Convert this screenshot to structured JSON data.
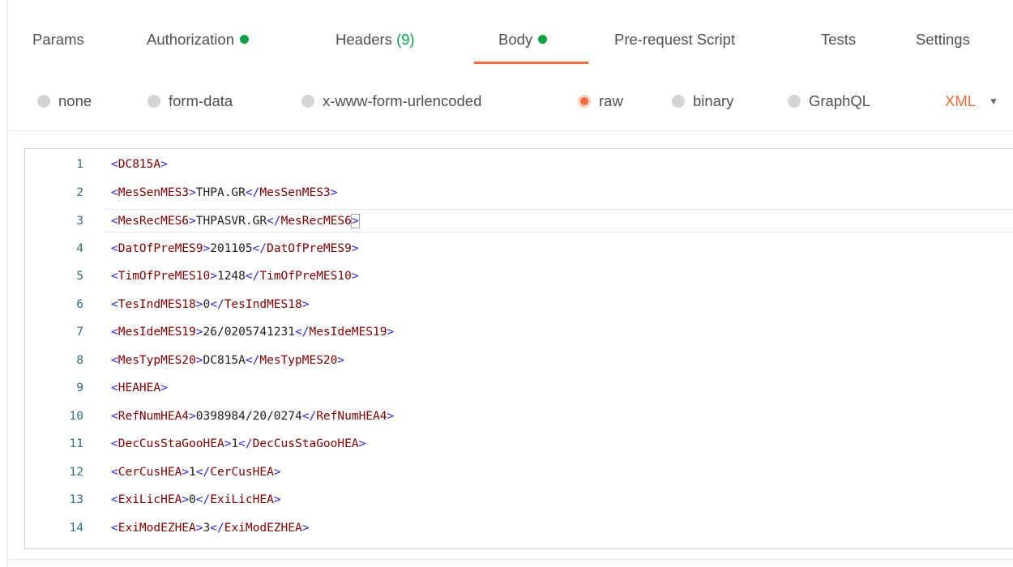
{
  "tabs": [
    {
      "label": "Params"
    },
    {
      "label": "Authorization"
    },
    {
      "label": "Headers",
      "count": "(9)"
    },
    {
      "label": "Body"
    },
    {
      "label": "Pre-request Script"
    },
    {
      "label": "Tests"
    },
    {
      "label": "Settings"
    }
  ],
  "active_tab": "Body",
  "body_modes": [
    {
      "label": "none"
    },
    {
      "label": "form-data"
    },
    {
      "label": "x-www-form-urlencoded"
    },
    {
      "label": "raw"
    },
    {
      "label": "binary"
    },
    {
      "label": "GraphQL"
    }
  ],
  "selected_mode": "raw",
  "language": "XML",
  "colors": {
    "accent": "#f26b3a",
    "indicator": "#0ca145"
  },
  "editor": {
    "lines": [
      {
        "n": "1",
        "open": "DC815A",
        "text": "",
        "close": ""
      },
      {
        "n": "2",
        "open": "MesSenMES3",
        "text": "THPA.GR",
        "close": "MesSenMES3"
      },
      {
        "n": "3",
        "open": "MesRecMES6",
        "text": "THPASVR.GR",
        "close": "MesRecMES6"
      },
      {
        "n": "4",
        "open": "DatOfPreMES9",
        "text": "201105",
        "close": "DatOfPreMES9"
      },
      {
        "n": "5",
        "open": "TimOfPreMES10",
        "text": "1248",
        "close": "TimOfPreMES10"
      },
      {
        "n": "6",
        "open": "TesIndMES18",
        "text": "0",
        "close": "TesIndMES18"
      },
      {
        "n": "7",
        "open": "MesIdeMES19",
        "text": "26/0205741231",
        "close": "MesIdeMES19"
      },
      {
        "n": "8",
        "open": "MesTypMES20",
        "text": "DC815A",
        "close": "MesTypMES20"
      },
      {
        "n": "9",
        "open": "HEAHEA",
        "text": "",
        "close": ""
      },
      {
        "n": "10",
        "open": "RefNumHEA4",
        "text": "0398984/20/0274",
        "close": "RefNumHEA4"
      },
      {
        "n": "11",
        "open": "DecCusStaGooHEA",
        "text": "1",
        "close": "DecCusStaGooHEA"
      },
      {
        "n": "12",
        "open": "CerCusHEA",
        "text": "1",
        "close": "CerCusHEA"
      },
      {
        "n": "13",
        "open": "ExiLicHEA",
        "text": "0",
        "close": "ExiLicHEA"
      },
      {
        "n": "14",
        "open": "ExiModEZHEA",
        "text": "3",
        "close": "ExiModEZHEA"
      }
    ],
    "active_line": "3"
  }
}
